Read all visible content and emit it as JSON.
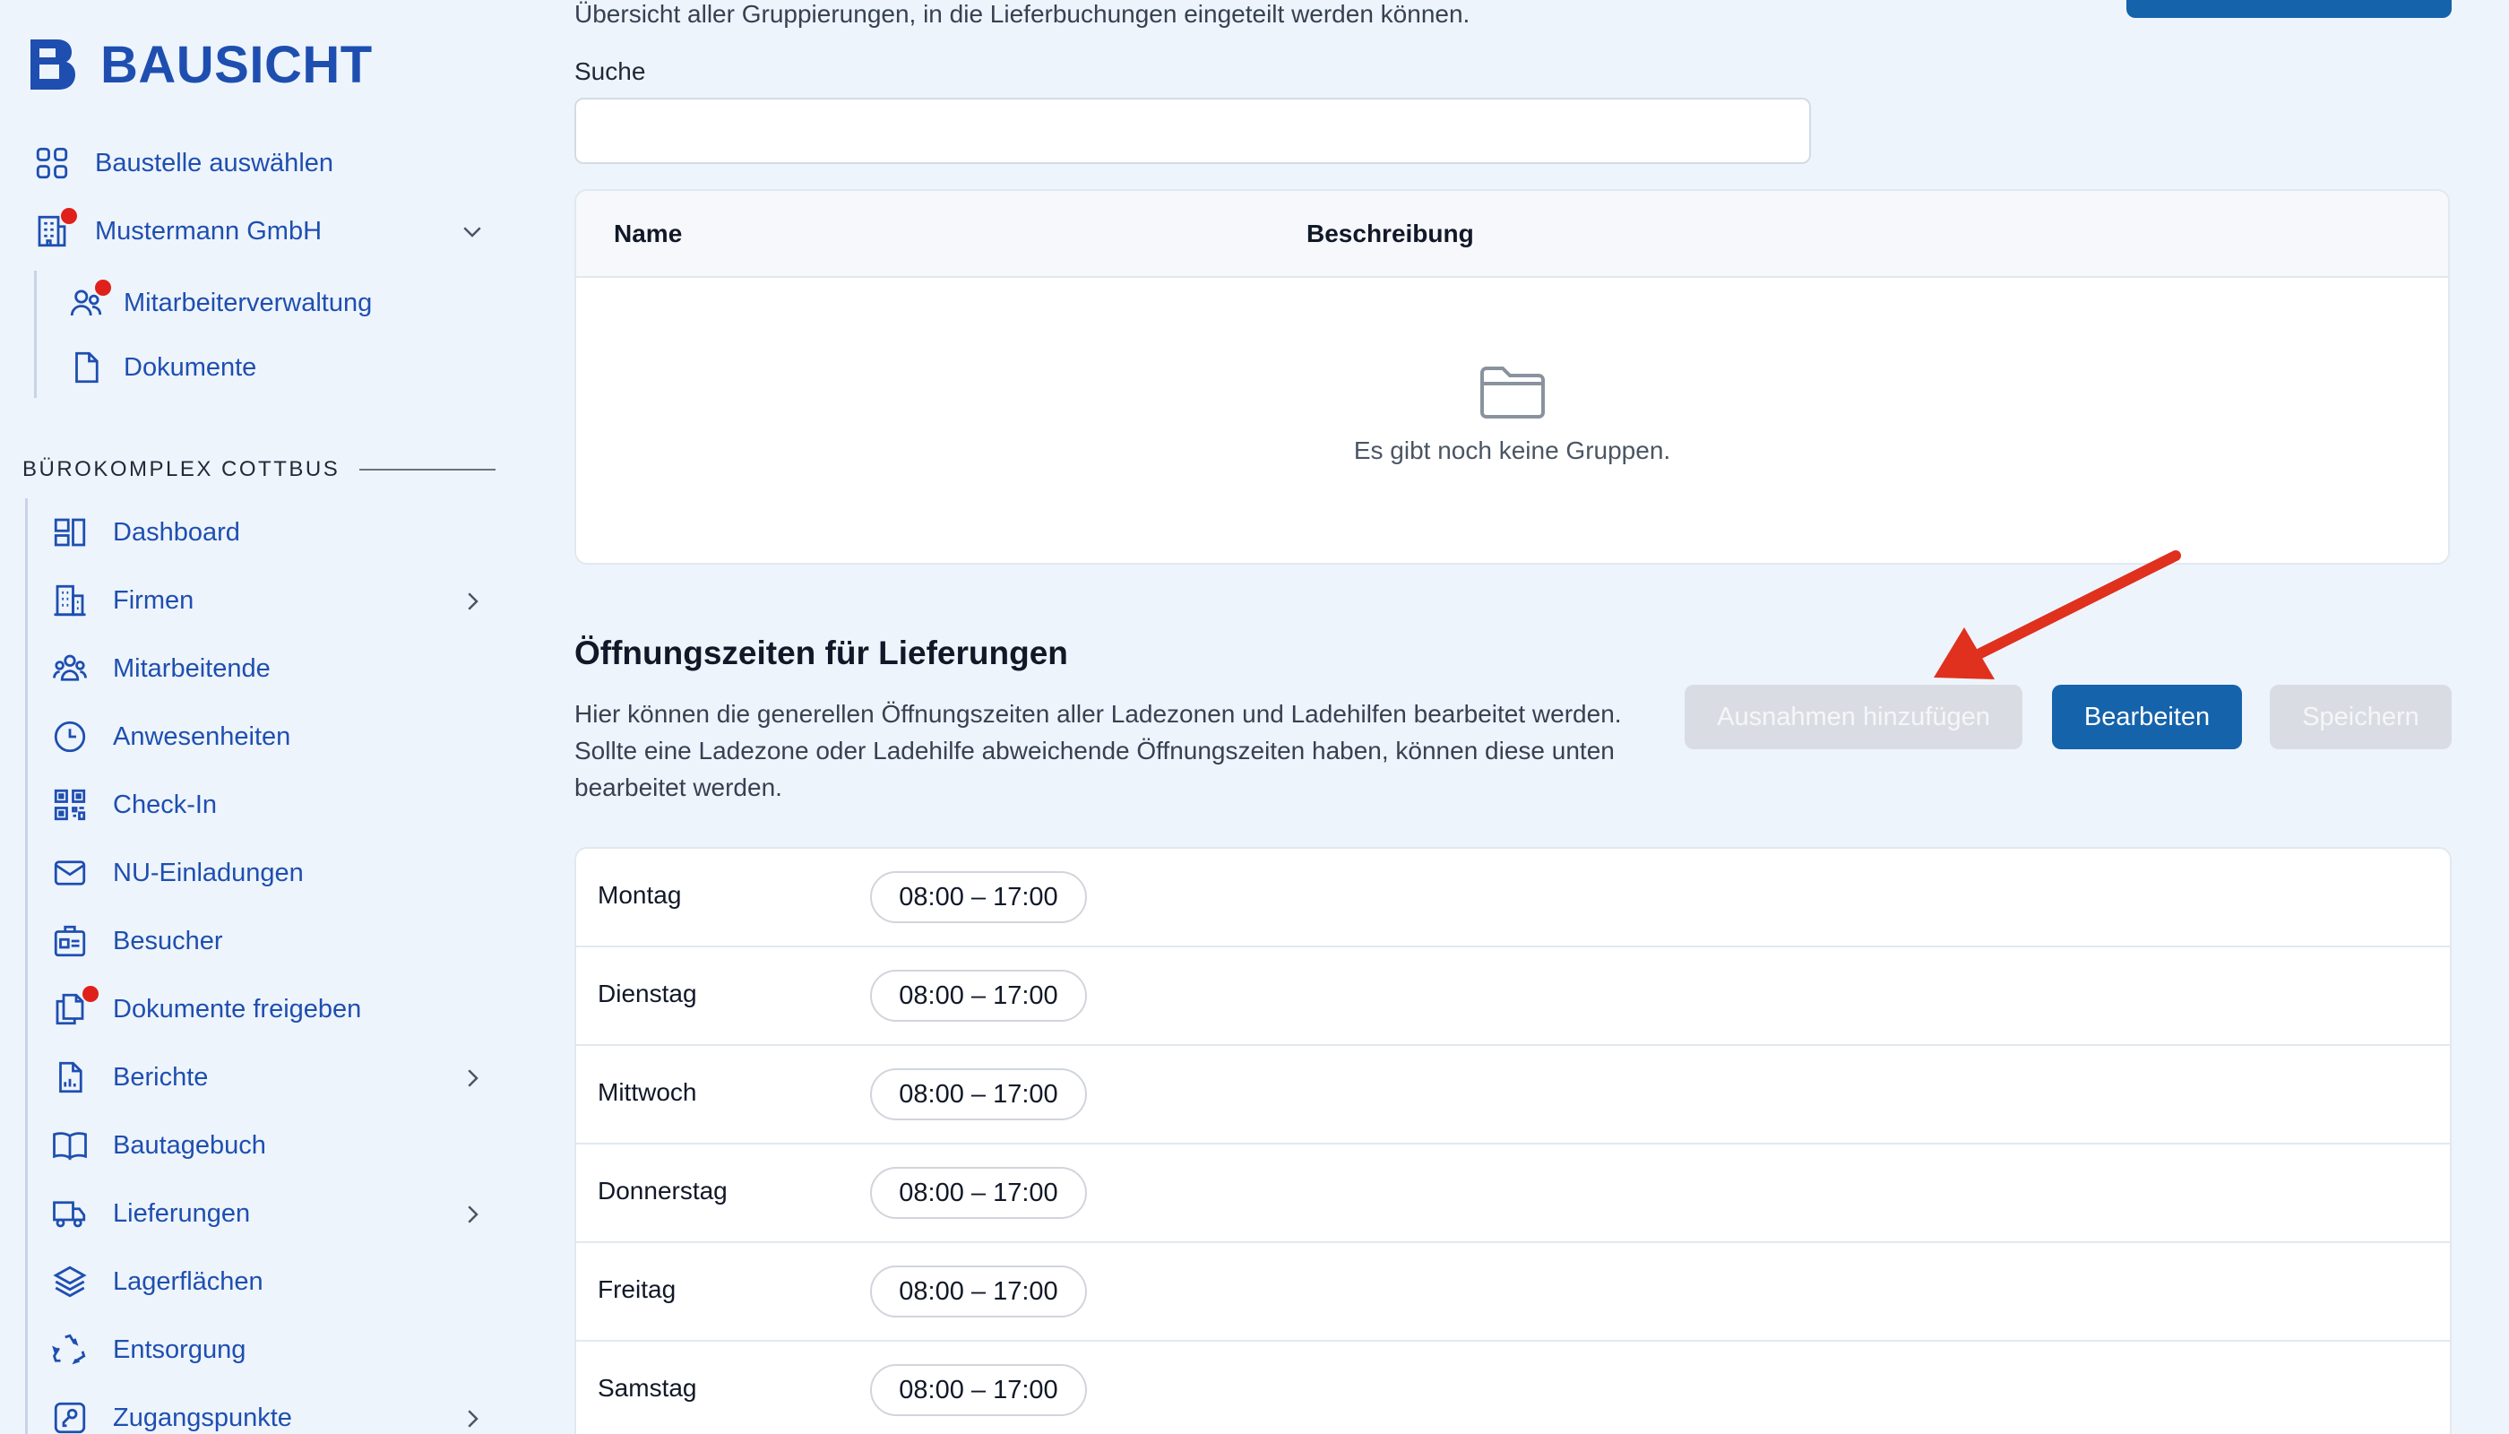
{
  "brand": {
    "name": "BAUSICHT"
  },
  "sidebar": {
    "top_items": [
      {
        "label": "Baustelle auswählen",
        "icon": "grid-icon"
      },
      {
        "label": "Mustermann GmbH",
        "icon": "building-icon"
      },
      {
        "label": "Mitarbeiterverwaltung",
        "icon": "users-icon"
      },
      {
        "label": "Dokumente",
        "icon": "document-icon"
      }
    ],
    "section_title": "BÜROKOMPLEX COTTBUS",
    "items": [
      {
        "label": "Dashboard",
        "icon": "dashboard-icon"
      },
      {
        "label": "Firmen",
        "icon": "building-icon"
      },
      {
        "label": "Mitarbeitende",
        "icon": "people-icon"
      },
      {
        "label": "Anwesenheiten",
        "icon": "clock-icon"
      },
      {
        "label": "Check-In",
        "icon": "qr-code-icon"
      },
      {
        "label": "NU-Einladungen",
        "icon": "mail-icon"
      },
      {
        "label": "Besucher",
        "icon": "id-badge-icon"
      },
      {
        "label": "Dokumente freigeben",
        "icon": "documents-icon"
      },
      {
        "label": "Berichte",
        "icon": "report-icon"
      },
      {
        "label": "Bautagebuch",
        "icon": "book-icon"
      },
      {
        "label": "Lieferungen",
        "icon": "truck-icon"
      },
      {
        "label": "Lagerflächen",
        "icon": "layers-icon"
      },
      {
        "label": "Entsorgung",
        "icon": "recycle-icon"
      },
      {
        "label": "Zugangspunkte",
        "icon": "key-icon"
      }
    ]
  },
  "groups": {
    "description": "Übersicht aller Gruppierungen, in die Lieferbuchungen eingeteilt werden können.",
    "search_label": "Suche",
    "search_value": "",
    "columns": [
      "Name",
      "Beschreibung"
    ],
    "empty_text": "Es gibt noch keine Gruppen."
  },
  "opening_hours": {
    "title": "Öffnungszeiten für Lieferungen",
    "description": "Hier können die generellen Öffnungszeiten aller Ladezonen und Ladehilfen bearbeitet werden. Sollte eine Ladezone oder Ladehilfe abweichende Öffnungszeiten haben, können diese unten bearbeitet werden.",
    "buttons": {
      "add_exceptions": "Ausnahmen hinzufügen",
      "edit": "Bearbeiten",
      "save": "Speichern"
    },
    "days": [
      {
        "day": "Montag",
        "hours": "08:00 – 17:00"
      },
      {
        "day": "Dienstag",
        "hours": "08:00 – 17:00"
      },
      {
        "day": "Mittwoch",
        "hours": "08:00 – 17:00"
      },
      {
        "day": "Donnerstag",
        "hours": "08:00 – 17:00"
      },
      {
        "day": "Freitag",
        "hours": "08:00 – 17:00"
      },
      {
        "day": "Samstag",
        "hours": "08:00 – 17:00"
      }
    ]
  },
  "colors": {
    "brand_blue": "#1e4fb0",
    "primary_button": "#1563ab",
    "disabled_button": "#d9dde3",
    "notification_dot": "#e0201a",
    "annotation_arrow": "#e0301e",
    "background": "#eef4fc"
  }
}
